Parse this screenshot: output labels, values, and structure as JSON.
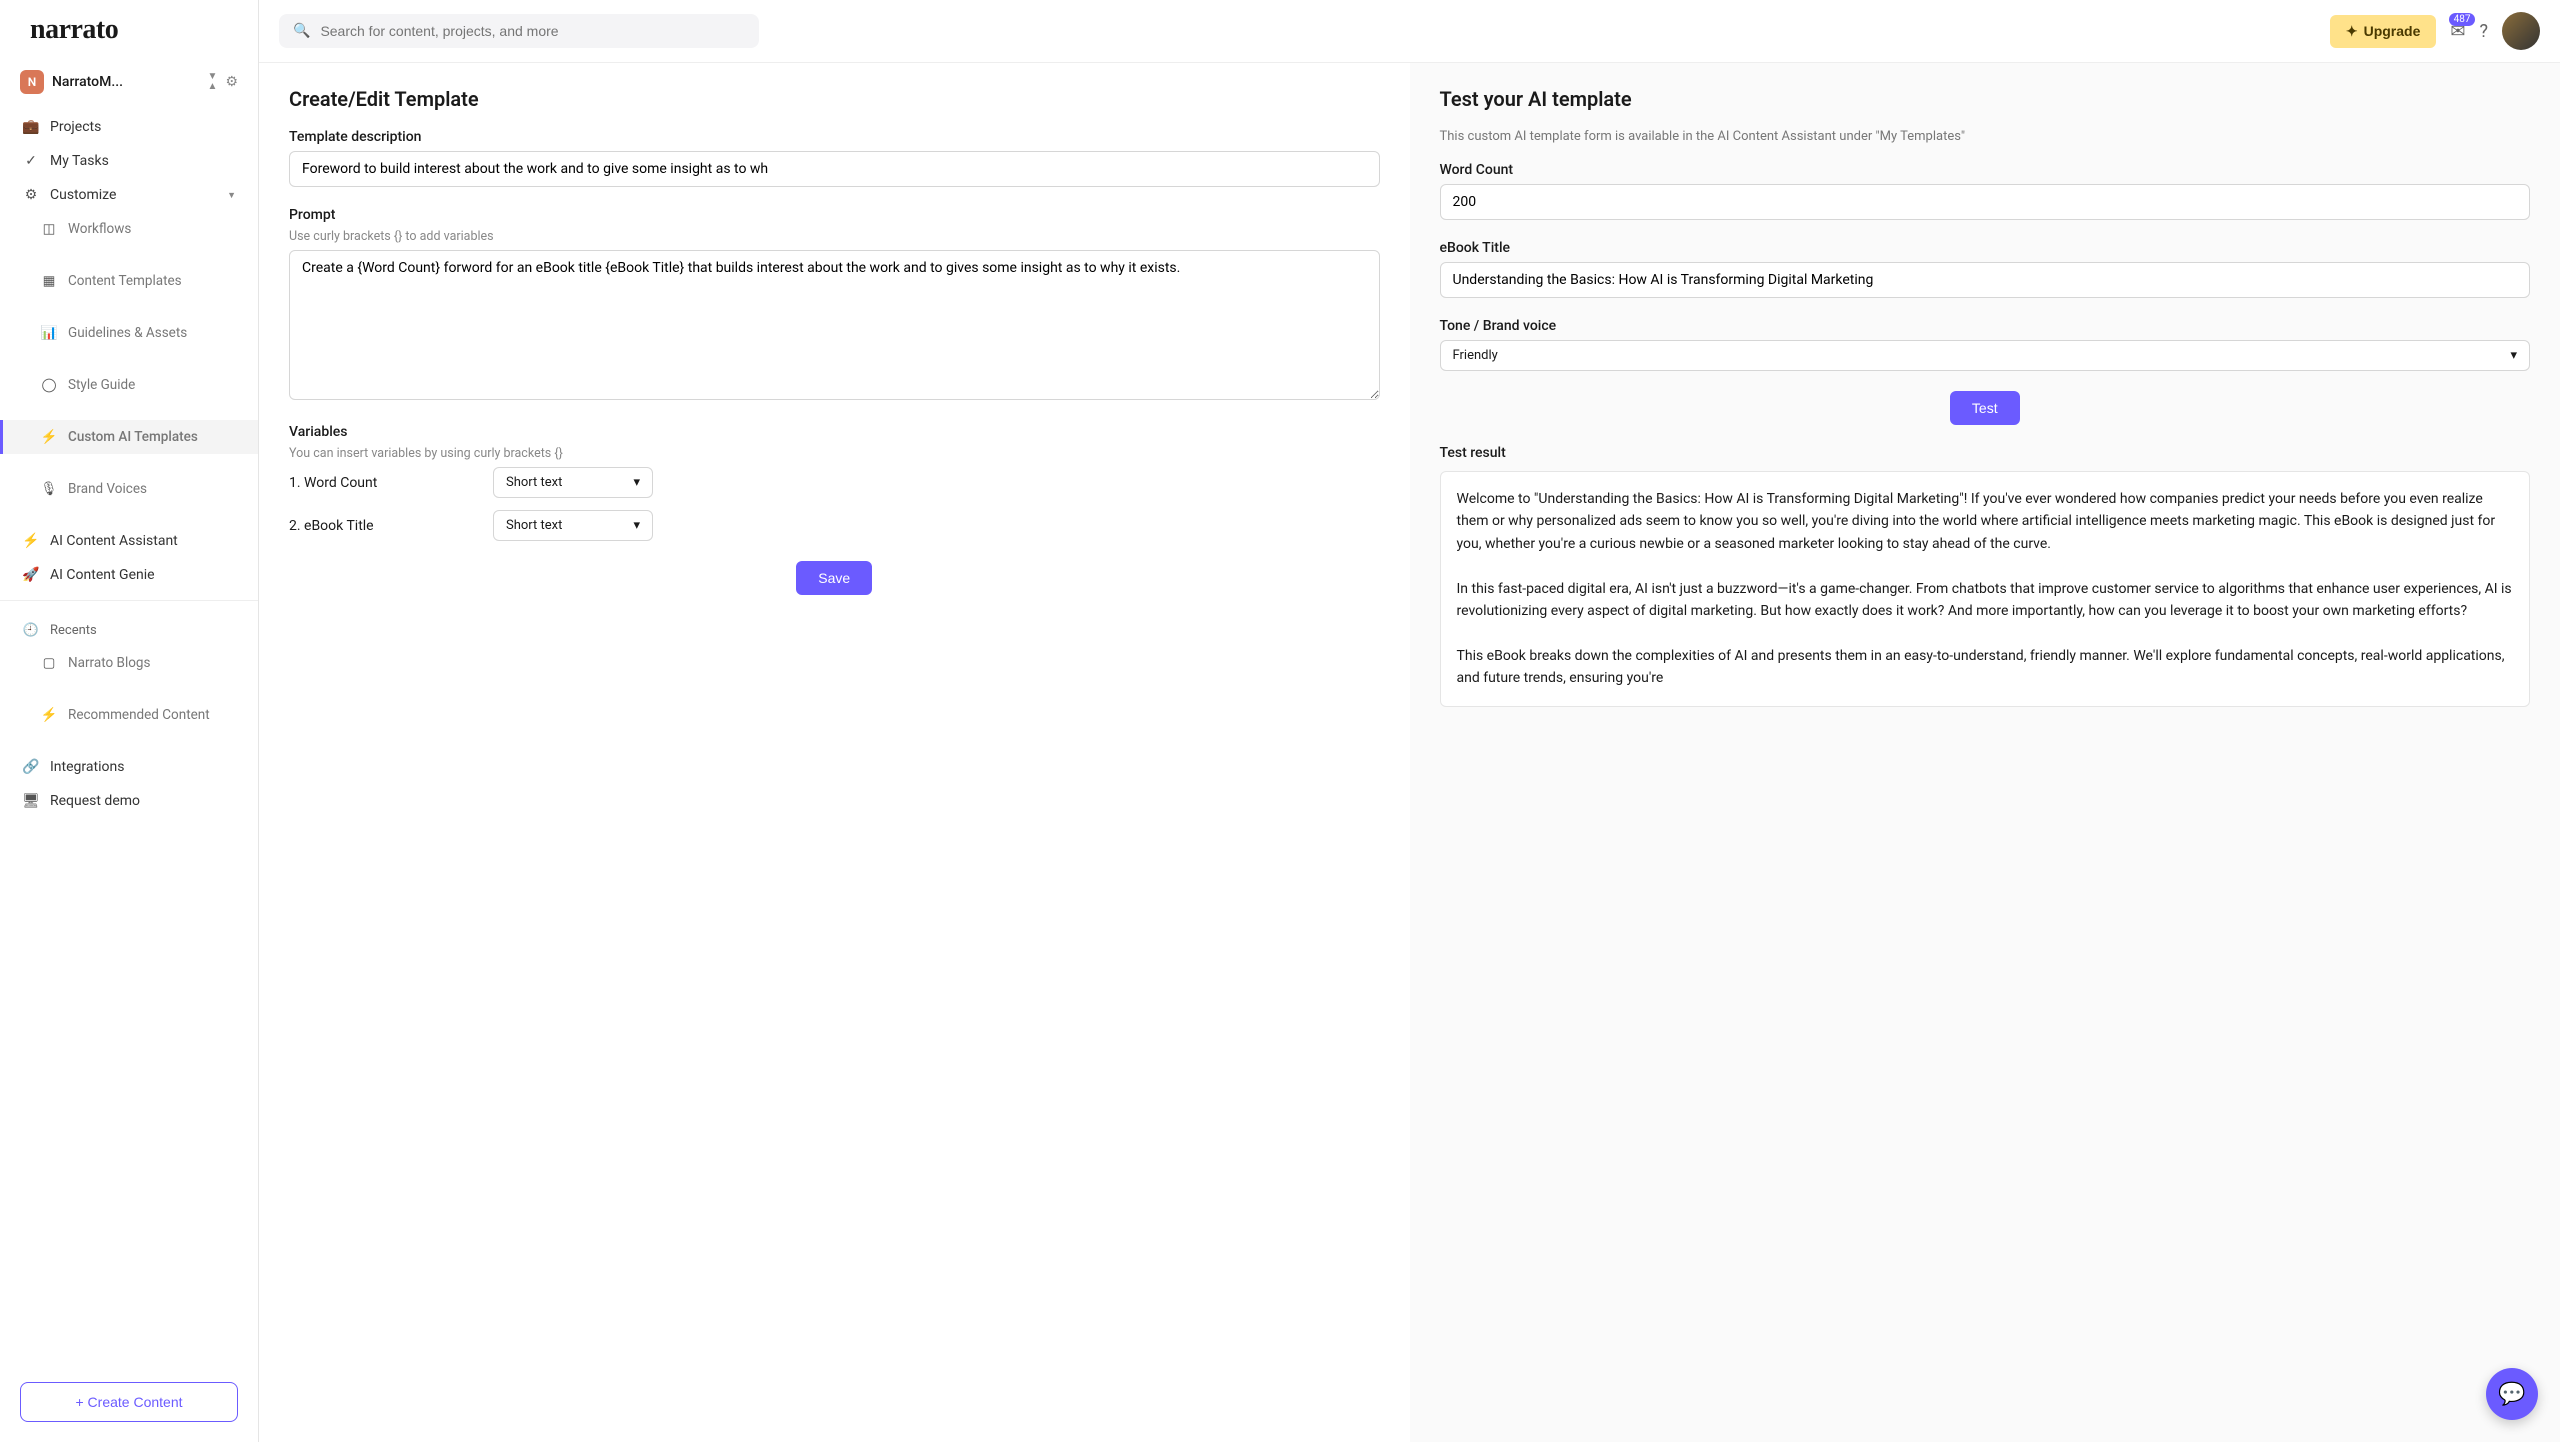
{
  "logo": "narrato",
  "workspace": {
    "initial": "N",
    "name": "NarratoM..."
  },
  "nav": {
    "projects": "Projects",
    "tasks": "My Tasks",
    "customize": "Customize",
    "workflows": "Workflows",
    "content_templates": "Content Templates",
    "guidelines": "Guidelines & Assets",
    "style_guide": "Style Guide",
    "custom_ai": "Custom AI Templates",
    "brand_voices": "Brand Voices",
    "ai_assistant": "AI Content Assistant",
    "ai_genie": "AI Content Genie",
    "recents": "Recents",
    "narrato_blogs": "Narrato Blogs",
    "recommended": "Recommended Content",
    "integrations": "Integrations",
    "request_demo": "Request demo",
    "create_content": "+ Create Content"
  },
  "topbar": {
    "search_placeholder": "Search for content, projects, and more",
    "upgrade": "Upgrade",
    "notif_count": "487"
  },
  "editor": {
    "title": "Create/Edit Template",
    "desc_label": "Template description",
    "desc_value": "Foreword to build interest about the work and to give some insight as to wh",
    "prompt_label": "Prompt",
    "prompt_hint": "Use curly brackets {} to add variables",
    "prompt_value": "Create a {Word Count} forword for an eBook title {eBook Title} that builds interest about the work and to gives some insight as to why it exists.",
    "vars_label": "Variables",
    "vars_hint": "You can insert variables by using curly brackets {}",
    "var1_label": "1. Word Count",
    "var2_label": "2. eBook Title",
    "var_type": "Short text",
    "save": "Save"
  },
  "test": {
    "title": "Test your AI template",
    "sub": "This custom AI template form is available in the AI Content Assistant under \"My Templates\"",
    "word_count_label": "Word Count",
    "word_count_value": "200",
    "ebook_label": "eBook Title",
    "ebook_value": "Understanding the Basics: How AI is Transforming Digital Marketing",
    "tone_label": "Tone / Brand voice",
    "tone_value": "Friendly",
    "test_btn": "Test",
    "result_label": "Test result",
    "result_text": "Welcome to \"Understanding the Basics: How AI is Transforming Digital Marketing\"! If you've ever wondered how companies predict your needs before you even realize them or why personalized ads seem to know you so well, you're diving into the world where artificial intelligence meets marketing magic. This eBook is designed just for you, whether you're a curious newbie or a seasoned marketer looking to stay ahead of the curve.\n\nIn this fast-paced digital era, AI isn't just a buzzword—it's a game-changer. From chatbots that improve customer service to algorithms that enhance user experiences, AI is revolutionizing every aspect of digital marketing. But how exactly does it work? And more importantly, how can you leverage it to boost your own marketing efforts?\n\nThis eBook breaks down the complexities of AI and presents them in an easy-to-understand, friendly manner. We'll explore fundamental concepts, real-world applications, and future trends, ensuring you're"
  }
}
